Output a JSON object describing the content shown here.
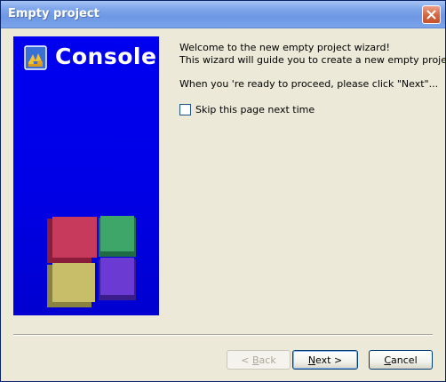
{
  "window": {
    "title": "Empty project"
  },
  "banner": {
    "title": "Console"
  },
  "intro": {
    "line1": "Welcome to the new empty project wizard!",
    "line2": "This wizard will guide you to create a new empty project.",
    "proceed": "When you 're ready to proceed, please click \"Next\"..."
  },
  "skip": {
    "label": "Skip this page next time",
    "checked": false
  },
  "buttons": {
    "back": {
      "prefix": "< ",
      "mnemonic": "B",
      "rest": "ack",
      "enabled": false
    },
    "next": {
      "mnemonic": "N",
      "rest": "ext >",
      "enabled": true
    },
    "cancel": {
      "mnemonic": "C",
      "rest": "ancel",
      "enabled": true
    }
  },
  "colors": {
    "banner": "#0000e6",
    "titlebar": "#7aa3ea",
    "dialog": "#ece9d8"
  },
  "icons": {
    "logo": "codeblocks-logo",
    "close": "close-icon",
    "cubes": "colored-cubes-graphic"
  }
}
